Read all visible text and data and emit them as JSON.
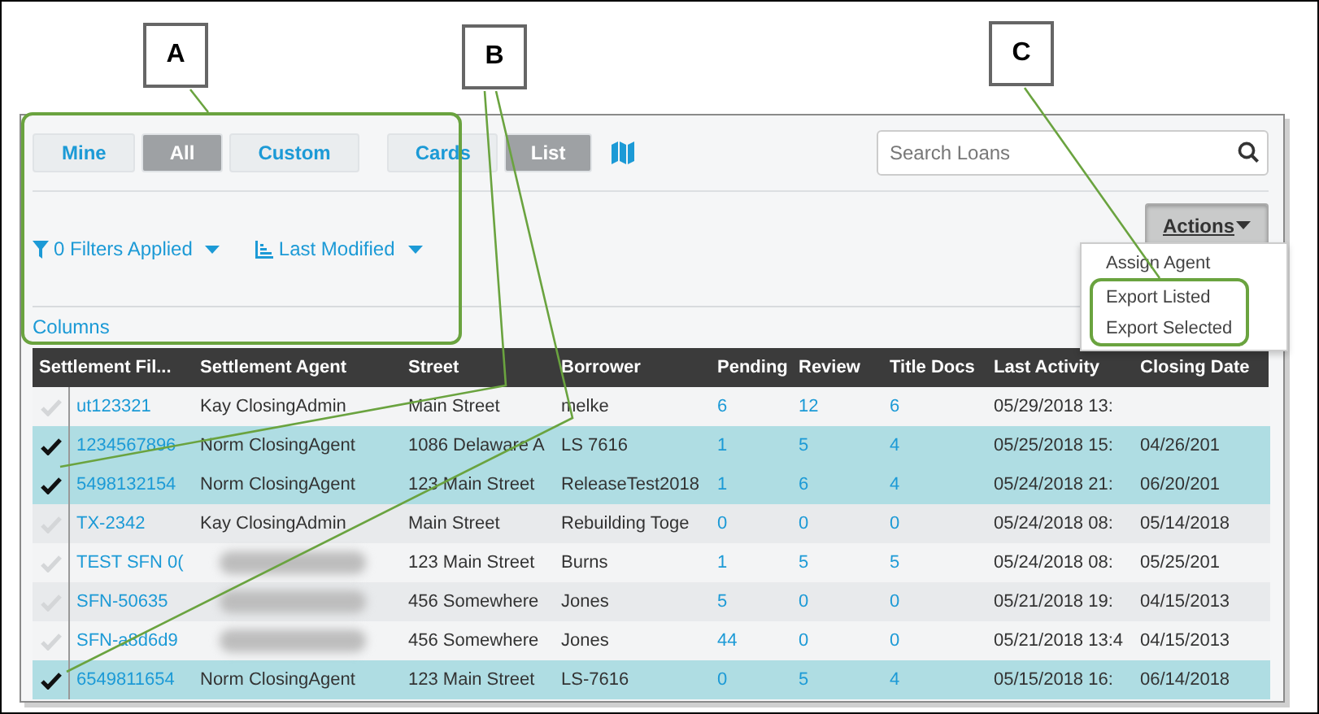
{
  "callouts": [
    {
      "label": "A"
    },
    {
      "label": "B"
    },
    {
      "label": "C"
    }
  ],
  "scope_tabs": [
    {
      "label": "Mine",
      "selected": false
    },
    {
      "label": "All",
      "selected": true
    },
    {
      "label": "Custom",
      "selected": false
    }
  ],
  "view_tabs": [
    {
      "label": "Cards",
      "selected": false
    },
    {
      "label": "List",
      "selected": true
    }
  ],
  "search": {
    "placeholder": "Search Loans"
  },
  "filters": {
    "label": "0 Filters Applied"
  },
  "sort": {
    "label": "Last Modified"
  },
  "columns_link": "Columns",
  "actions": {
    "label": "Actions",
    "expanded": true,
    "items": [
      {
        "label": "Assign Agent"
      },
      {
        "label": "Export Listed"
      },
      {
        "label": "Export Selected"
      }
    ]
  },
  "table": {
    "columns": [
      "Settlement Fil...",
      "Settlement Agent",
      "Street",
      "Borrower",
      "Pending",
      "Review",
      "Title Docs",
      "Last Activity",
      "Closing Date"
    ],
    "rows": [
      {
        "selected": false,
        "agent_blurred": false,
        "file": "ut123321",
        "agent": "Kay ClosingAdmin",
        "street": "Main Street",
        "borrower": "melke",
        "pending": "6",
        "review": "12",
        "title_docs": "6",
        "last_activity": "05/29/2018 13:"
      },
      {
        "selected": true,
        "agent_blurred": false,
        "file": "1234567896",
        "agent": "Norm ClosingAgent",
        "street": "1086 Delaware A",
        "borrower": "LS 7616",
        "pending": "1",
        "review": "5",
        "title_docs": "4",
        "last_activity": "05/25/2018 15:",
        "closing_date": "04/26/201"
      },
      {
        "selected": true,
        "agent_blurred": false,
        "file": "5498132154",
        "agent": "Norm ClosingAgent",
        "street": "123 Main Street",
        "borrower": "ReleaseTest2018",
        "pending": "1",
        "review": "6",
        "title_docs": "4",
        "last_activity": "05/24/2018 21:",
        "closing_date": "06/20/201"
      },
      {
        "selected": false,
        "agent_blurred": false,
        "file": "TX-2342",
        "agent": "Kay ClosingAdmin",
        "street": "Main Street",
        "borrower": "Rebuilding Toge",
        "pending": "0",
        "review": "0",
        "title_docs": "0",
        "last_activity": "05/24/2018 08:",
        "closing_date": "05/14/2018"
      },
      {
        "selected": false,
        "agent_blurred": true,
        "file": "TEST SFN 0(",
        "street": "123 Main Street",
        "borrower": "Burns",
        "pending": "1",
        "review": "5",
        "title_docs": "5",
        "last_activity": "05/24/2018 08:",
        "closing_date": "05/25/201"
      },
      {
        "selected": false,
        "agent_blurred": true,
        "file": "SFN-50635",
        "street": "456 Somewhere",
        "borrower": "Jones",
        "pending": "5",
        "review": "0",
        "title_docs": "0",
        "last_activity": "05/21/2018 19:",
        "closing_date": "04/15/2013"
      },
      {
        "selected": false,
        "agent_blurred": true,
        "file": "SFN-a8d6d9",
        "street": "456 Somewhere",
        "borrower": "Jones",
        "pending": "44",
        "review": "0",
        "title_docs": "0",
        "last_activity": "05/21/2018 13:4",
        "closing_date": "04/15/2013"
      },
      {
        "selected": true,
        "agent_blurred": false,
        "file": "6549811654",
        "agent": "Norm ClosingAgent",
        "street": "123 Main Street",
        "borrower": "LS-7616",
        "pending": "0",
        "review": "5",
        "title_docs": "4",
        "last_activity": "05/15/2018 16:",
        "closing_date": "06/14/2018"
      }
    ]
  }
}
